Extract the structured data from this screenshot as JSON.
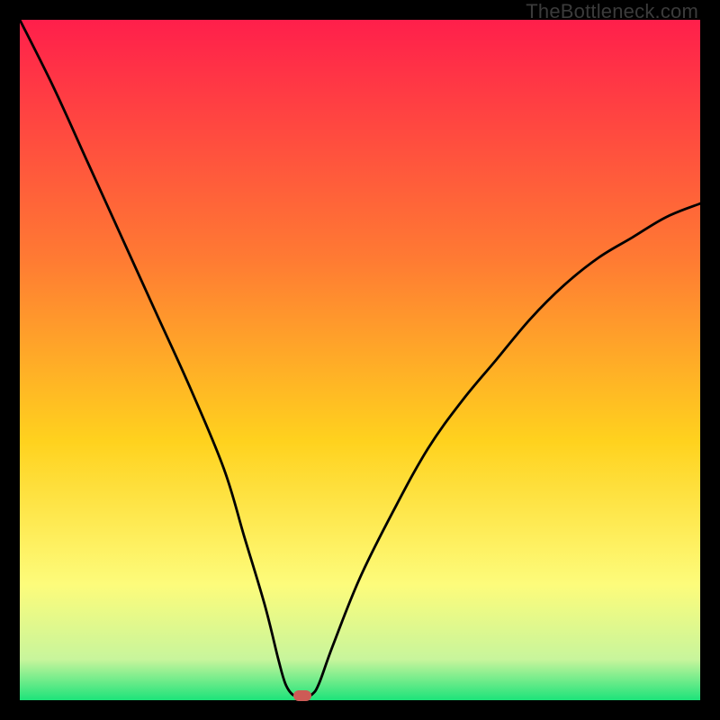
{
  "watermark": "TheBottleneck.com",
  "colors": {
    "top": "#ff1f4b",
    "mid1": "#ff7a33",
    "mid2": "#ffd21e",
    "mid3": "#fdfc7b",
    "mid4": "#c8f59c",
    "bottom": "#1de37a",
    "frame": "#000000",
    "curve": "#000000",
    "marker": "#cd5b56"
  },
  "chart_data": {
    "type": "line",
    "title": "",
    "xlabel": "",
    "ylabel": "",
    "xlim": [
      0,
      100
    ],
    "ylim": [
      0,
      100
    ],
    "series": [
      {
        "name": "curve",
        "x": [
          0,
          5,
          10,
          15,
          20,
          25,
          30,
          33,
          36,
          38,
          39,
          40,
          41,
          42,
          43,
          44,
          46,
          50,
          55,
          60,
          65,
          70,
          75,
          80,
          85,
          90,
          95,
          100
        ],
        "values": [
          100,
          90,
          79,
          68,
          57,
          46,
          34,
          24,
          14,
          6,
          2.5,
          0.9,
          0.6,
          0.6,
          0.9,
          2.5,
          8,
          18,
          28,
          37,
          44,
          50,
          56,
          61,
          65,
          68,
          71,
          73
        ]
      }
    ],
    "marker": {
      "x": 41.5,
      "y": 0.6,
      "color": "#cd5b56"
    }
  }
}
